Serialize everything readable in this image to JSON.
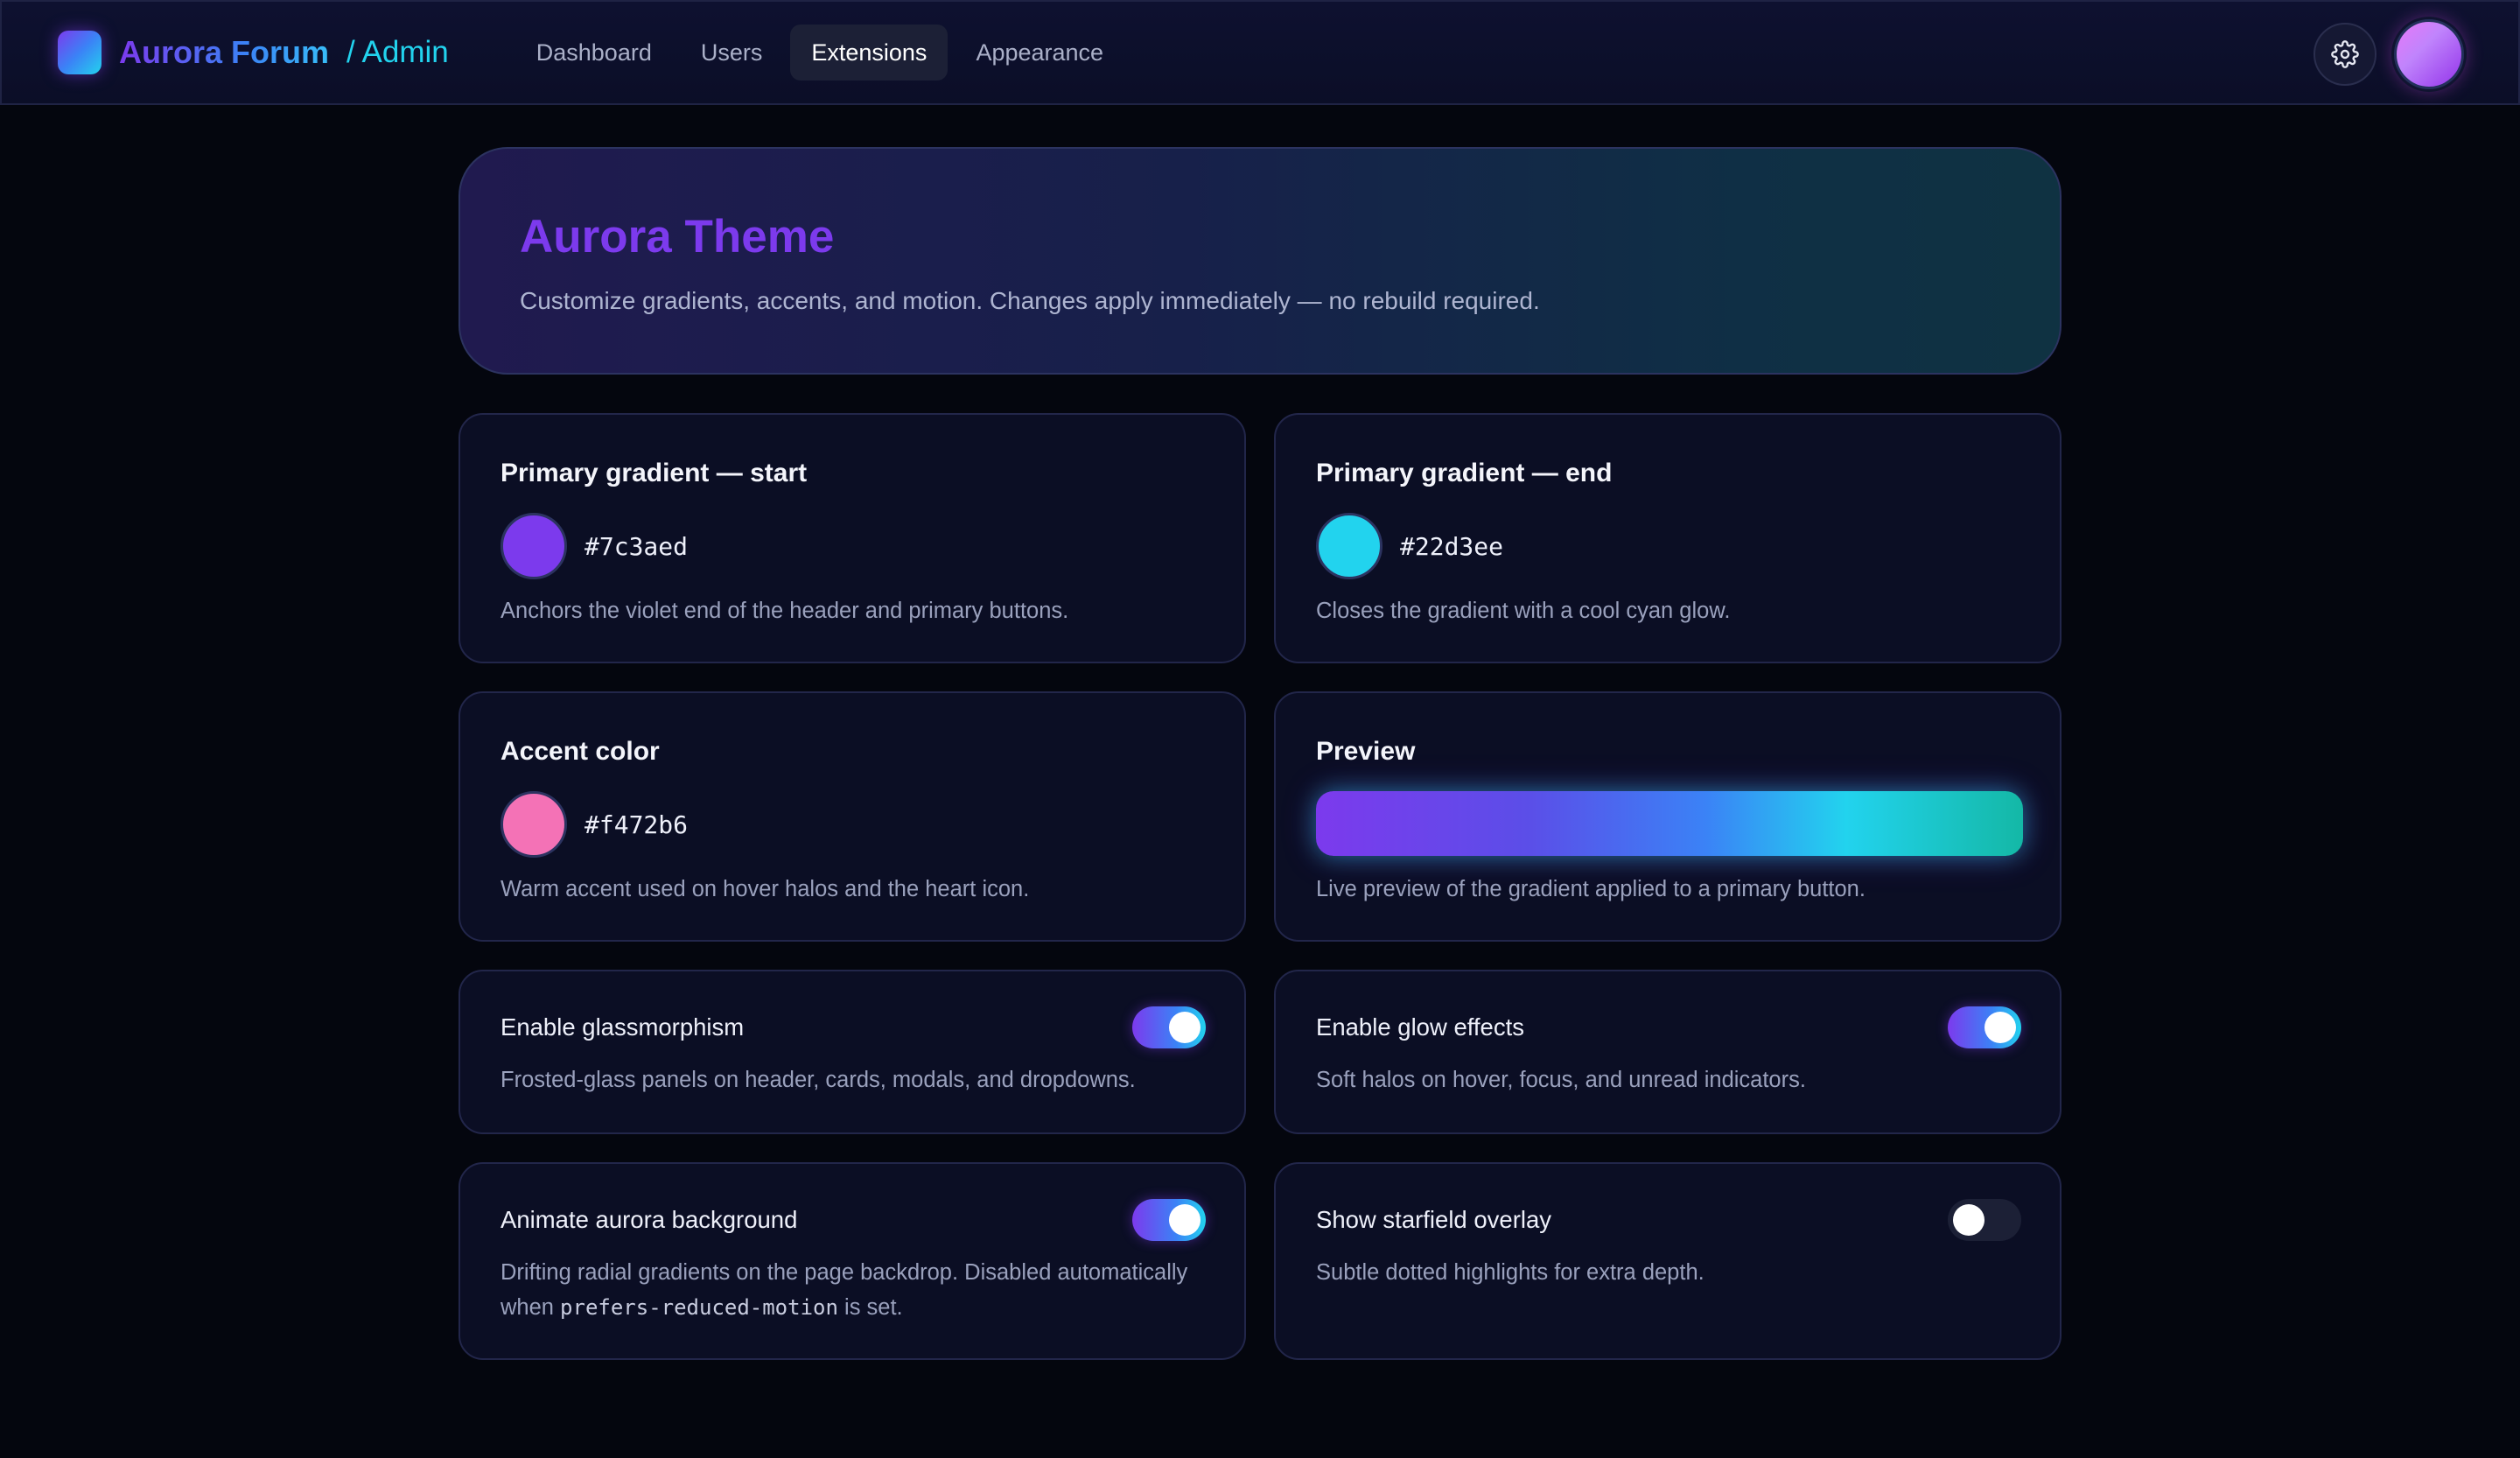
{
  "header": {
    "brand": "Aurora Forum",
    "section": "/ Admin",
    "nav": [
      {
        "label": "Dashboard",
        "active": false
      },
      {
        "label": "Users",
        "active": false
      },
      {
        "label": "Extensions",
        "active": true
      },
      {
        "label": "Appearance",
        "active": false
      }
    ],
    "icons": {
      "settings": "gear-icon",
      "avatar": "user-avatar"
    }
  },
  "hero": {
    "title": "Aurora Theme",
    "description": "Customize gradients, accents, and motion. Changes apply immediately — no rebuild required."
  },
  "colors": {
    "gradient_start": {
      "title": "Primary gradient — start",
      "hex": "#7c3aed",
      "description": "Anchors the violet end of the header and primary buttons."
    },
    "gradient_end": {
      "title": "Primary gradient — end",
      "hex": "#22d3ee",
      "description": "Closes the gradient with a cool cyan glow."
    },
    "accent": {
      "title": "Accent color",
      "hex": "#f472b6",
      "description": "Warm accent used on hover halos and the heart icon."
    },
    "preview": {
      "title": "Preview",
      "description": "Live preview of the gradient applied to a primary button."
    }
  },
  "toggles": {
    "glassmorphism": {
      "label": "Enable glassmorphism",
      "enabled": true,
      "description": "Frosted-glass panels on header, cards, modals, and dropdowns."
    },
    "glow": {
      "label": "Enable glow effects",
      "enabled": true,
      "description": "Soft halos on hover, focus, and unread indicators."
    },
    "aurora_bg": {
      "label": "Animate aurora background",
      "enabled": true,
      "description_before": "Drifting radial gradients on the page backdrop. Disabled automatically when ",
      "description_code": "prefers-reduced-motion",
      "description_after": " is set."
    },
    "starfield": {
      "label": "Show starfield overlay",
      "enabled": false,
      "description": "Subtle dotted highlights for extra depth."
    }
  },
  "theme_colors": {
    "page_bg": "#04060e",
    "card_bg": "#0b0e24",
    "violet": "#7c3aed",
    "cyan": "#22d3ee",
    "pink": "#f472b6"
  }
}
